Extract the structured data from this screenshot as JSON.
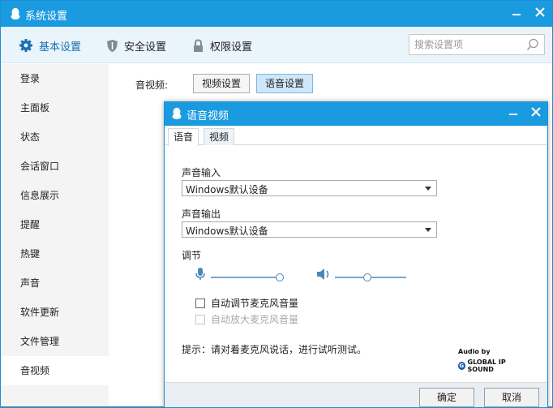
{
  "window": {
    "title": "系统设置"
  },
  "toolbar": {
    "items": [
      {
        "label": "基本设置"
      },
      {
        "label": "安全设置"
      },
      {
        "label": "权限设置"
      }
    ],
    "search_placeholder": "搜索设置项"
  },
  "sidebar": {
    "items": [
      {
        "label": "登录"
      },
      {
        "label": "主面板"
      },
      {
        "label": "状态"
      },
      {
        "label": "会话窗口"
      },
      {
        "label": "信息展示"
      },
      {
        "label": "提醒"
      },
      {
        "label": "热键"
      },
      {
        "label": "声音"
      },
      {
        "label": "软件更新"
      },
      {
        "label": "文件管理"
      },
      {
        "label": "音视频"
      }
    ],
    "selected": "音视频"
  },
  "main": {
    "av_label": "音视频:",
    "video_btn": "视频设置",
    "audio_btn": "语音设置"
  },
  "dialog": {
    "title": "语音视频",
    "tabs": [
      {
        "label": "语音"
      },
      {
        "label": "视频"
      }
    ],
    "input_label": "声音输入",
    "input_value": "Windows默认设备",
    "output_label": "声音输出",
    "output_value": "Windows默认设备",
    "adjust_label": "调节",
    "mic_level": 1.0,
    "speaker_level": 0.45,
    "auto_adjust_label": "自动调节麦克风音量",
    "auto_amplify_label": "自动放大麦克风音量",
    "hint": "提示：请对着麦克风说话，进行试听测试。",
    "logo_line1": "Audio by",
    "logo_line2": "GLOBAL IP SOUND",
    "ok_label": "确定",
    "cancel_label": "取消"
  },
  "colors": {
    "titlebar": "#1a9be0",
    "toolbar_bg": "#eaf4fb",
    "sidebar_bg": "#f4f4f4"
  }
}
